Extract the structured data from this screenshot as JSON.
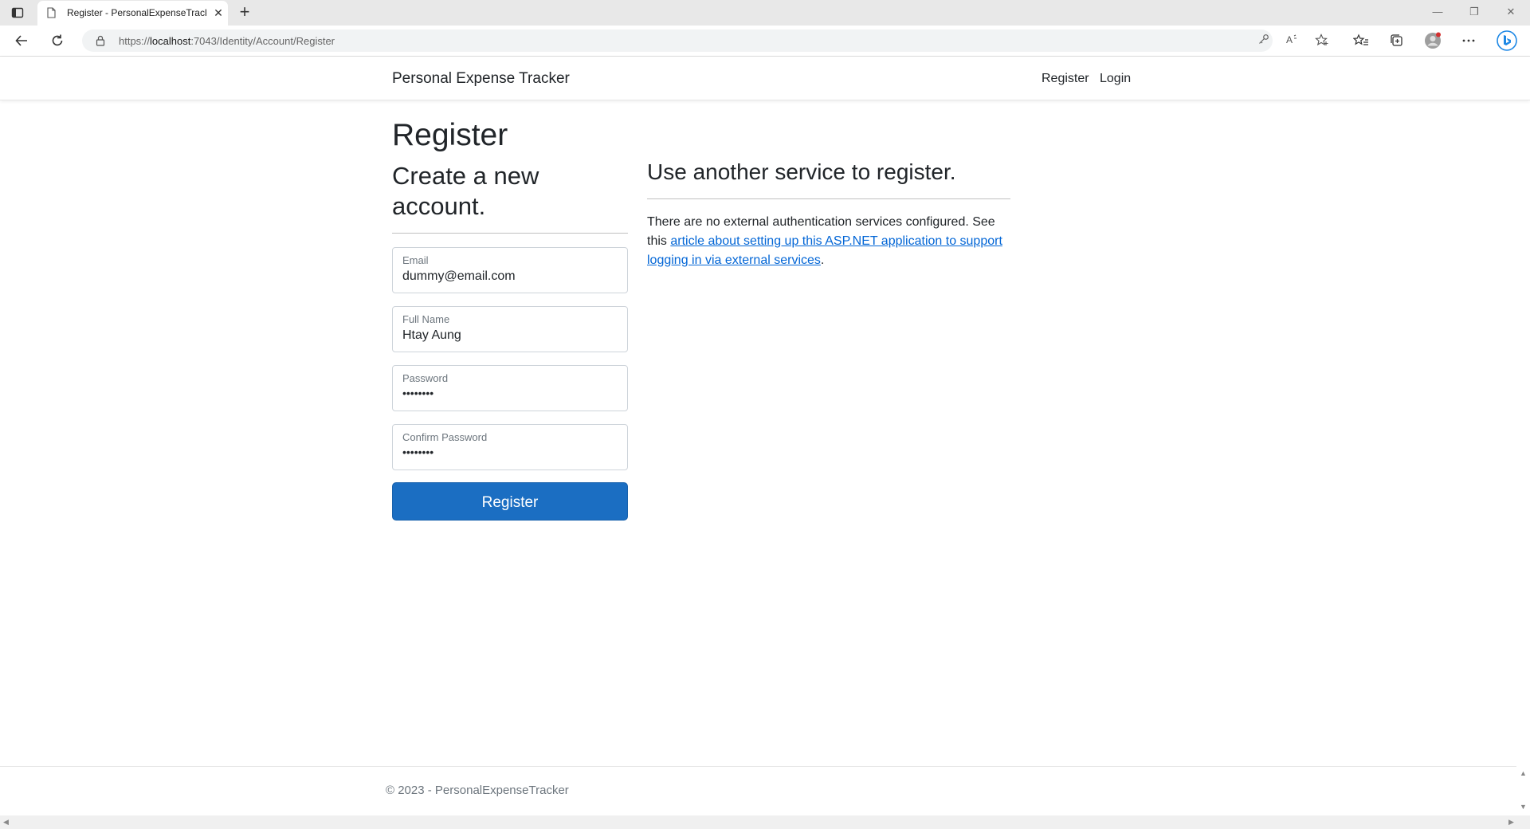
{
  "browser": {
    "tab_title": "Register - PersonalExpenseTracker",
    "tab_close": "✕",
    "new_tab": "+",
    "url_prefix": "https://",
    "url_host": "localhost",
    "url_rest": ":7043/Identity/Account/Register",
    "window_minimize": "—",
    "window_restore": "❐",
    "window_close": "✕"
  },
  "navbar": {
    "brand": "Personal Expense Tracker",
    "register": "Register",
    "login": "Login"
  },
  "main": {
    "title": "Register",
    "subtitle": "Create a new account.",
    "fields": [
      {
        "label": "Email",
        "value": "dummy@email.com"
      },
      {
        "label": "Full Name",
        "value": "Htay Aung"
      },
      {
        "label": "Password",
        "value": "••••••••"
      },
      {
        "label": "Confirm Password",
        "value": "••••••••"
      }
    ],
    "submit": "Register"
  },
  "external": {
    "heading": "Use another service to register.",
    "text_before": "There are no external authentication services configured. See this ",
    "link_text": "article about setting up this ASP.NET application to support logging in via external services",
    "text_after": "."
  },
  "footer": {
    "text": "© 2023 - PersonalExpenseTracker"
  },
  "colors": {
    "primary": "#1b6ec2",
    "link": "#0366d6"
  }
}
